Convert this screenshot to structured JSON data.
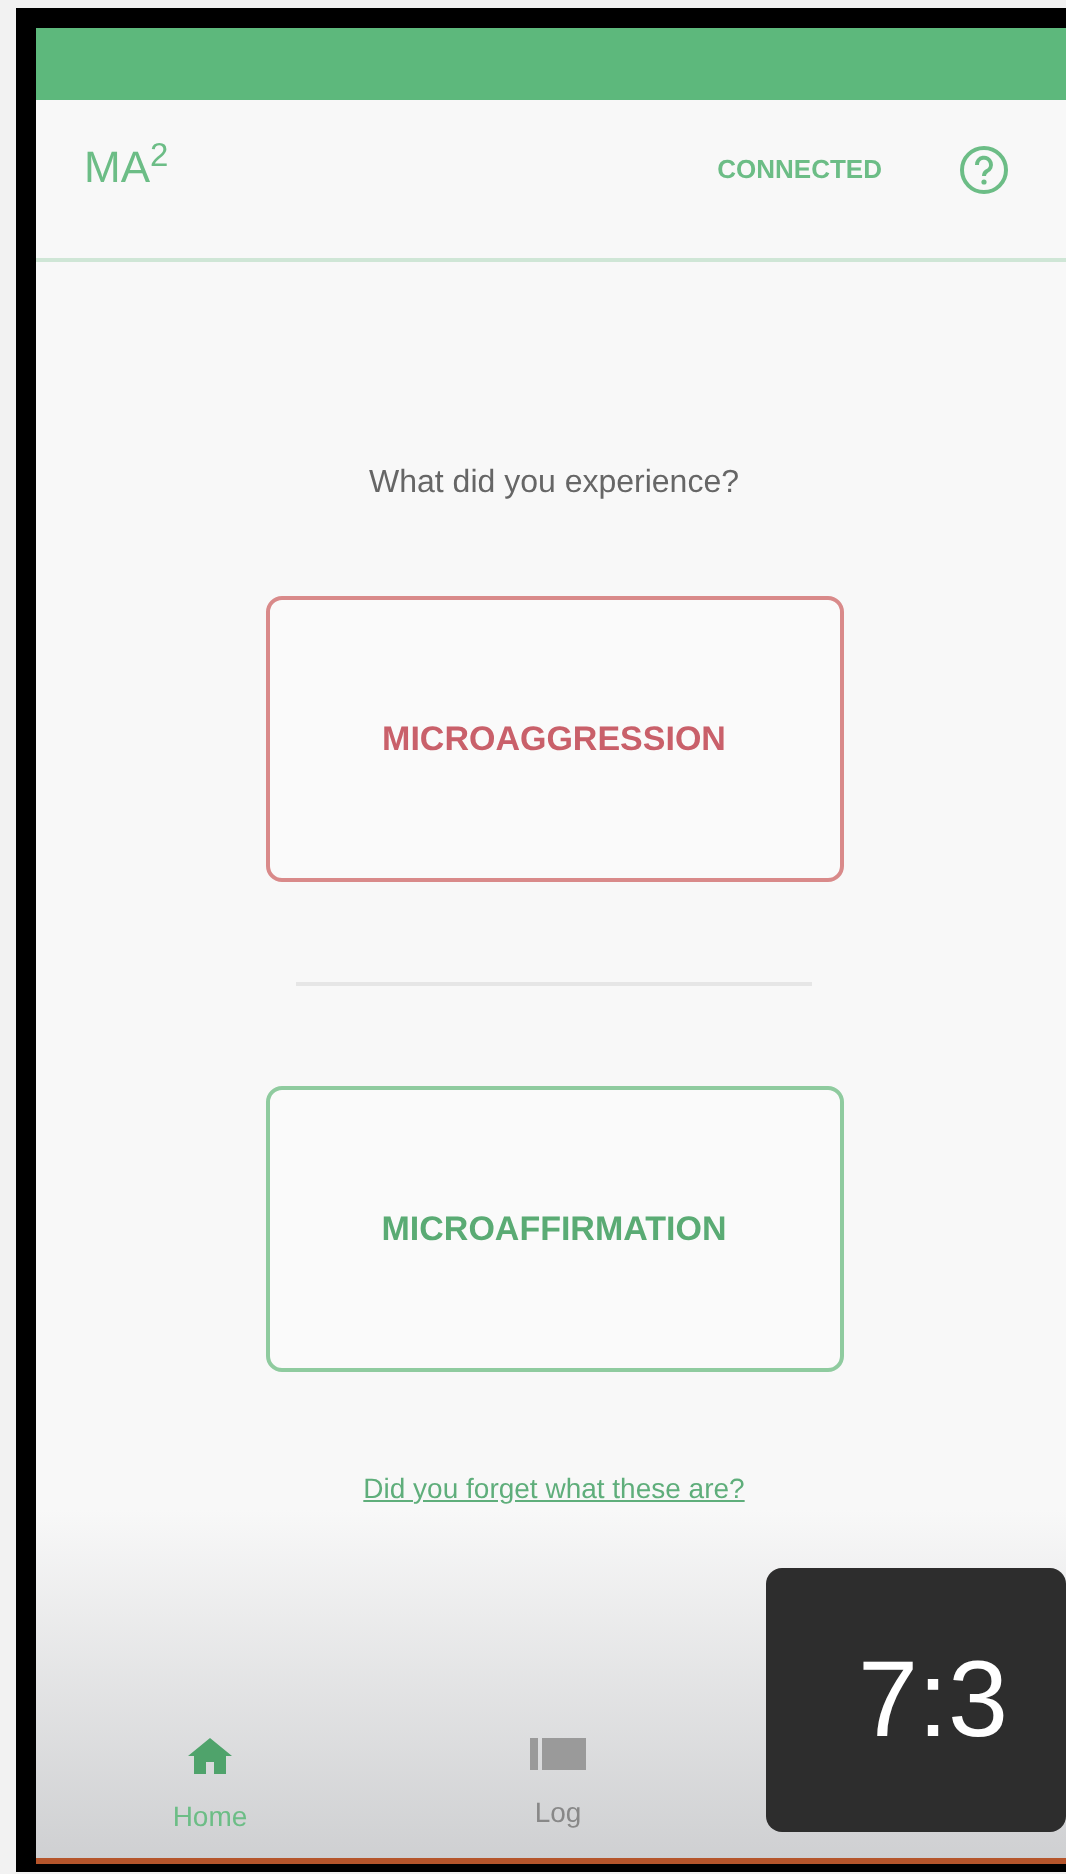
{
  "app_bar": {
    "title": "MA$^{2}$",
    "status": "CONNECTED"
  },
  "prompt": "What did you experience?",
  "choices": [
    {
      "label": "MICROAGGRESSION",
      "kind": "negative"
    },
    {
      "label": "MICROAFFIRMATION",
      "kind": "positive"
    }
  ],
  "help_link": "Did you forget what these are?",
  "bottom_nav": [
    {
      "label": "Home",
      "kind": "home",
      "selected": true
    },
    {
      "label": "Log",
      "kind": "list",
      "selected": false
    }
  ],
  "video_overlay": {
    "timestamp": "7:3"
  }
}
